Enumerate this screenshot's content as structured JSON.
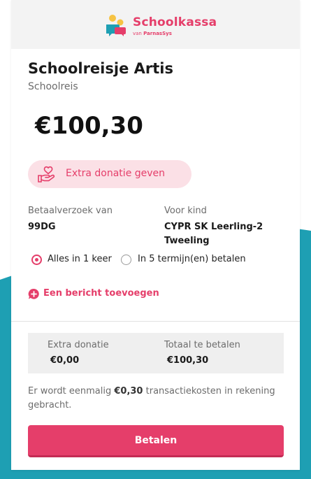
{
  "brand": {
    "name": "Schoolkassa",
    "sub_prefix": "van",
    "sub_brand": "ParnasSys",
    "colors": {
      "accent": "#e53e6a",
      "teal": "#1e9fb3",
      "yellow": "#f6c343",
      "blue": "#29a3d6"
    }
  },
  "payment": {
    "title": "Schoolreisje Artis",
    "subtitle": "Schoolreis",
    "amount": "€100,30"
  },
  "donation_button": {
    "label": "Extra donatie geven",
    "icon": "heart-hand-icon"
  },
  "details": {
    "requester_label": "Betaalverzoek van",
    "requester_value": "99DG",
    "child_label": "Voor kind",
    "child_value_line1": "CYPR SK Leerling-2",
    "child_value_line2": "Tweeling"
  },
  "options": {
    "selected": "Alles in 1 keer",
    "items": [
      "Alles in 1 keer",
      "In 5 termijn(en) betalen"
    ]
  },
  "message_link": {
    "label": "Een bericht toevoegen",
    "icon": "plus-chat-icon"
  },
  "summary": {
    "donation_label": "Extra donatie",
    "donation_value": "€0,00",
    "total_label": "Totaal te betalen",
    "total_value": "€100,30"
  },
  "note": {
    "prefix": "Er wordt eenmalig",
    "fee": "€0,30",
    "suffix": "transactiekosten in rekening gebracht."
  },
  "pay_button": {
    "label": "Betalen"
  }
}
